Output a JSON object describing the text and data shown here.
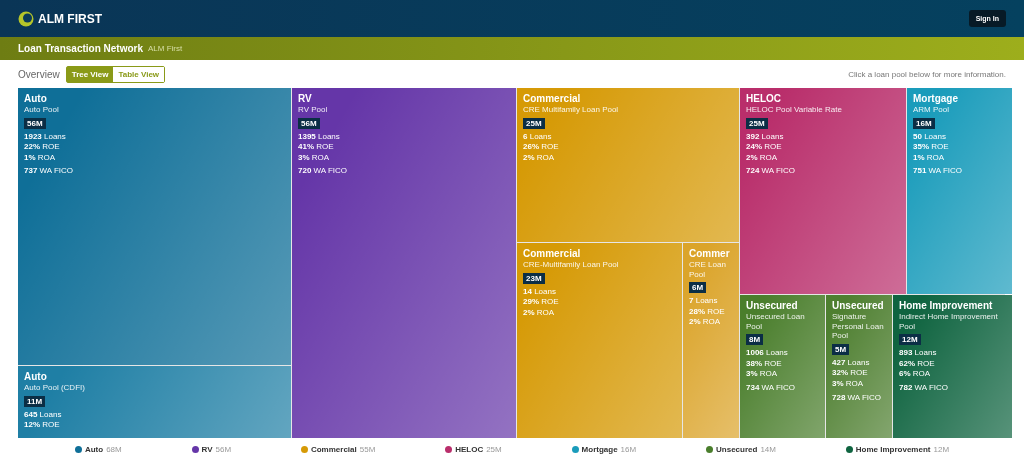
{
  "header": {
    "brand": "ALM FIRST",
    "sign_in": "Sign In"
  },
  "banner": {
    "title": "Loan Transaction Network",
    "subtitle": "ALM First"
  },
  "overview": {
    "title": "Overview",
    "hint": "Click a loan pool below for more information.",
    "views": [
      {
        "label": "Tree View",
        "selected": true
      },
      {
        "label": "Table View",
        "selected": false
      }
    ]
  },
  "tiles": [
    {
      "title": "Auto",
      "pool": "Auto Pool",
      "amount": "56M",
      "color": "#0f6f98",
      "loans": "**1923** Loans",
      "roe": "**22%** ROE",
      "roa": "**1%** ROA",
      "fico": "**737** WA FICO"
    },
    {
      "title": "Auto",
      "pool": "Auto Pool (CDFI)",
      "amount": "11M",
      "color": "#1f7fa5",
      "loans": "**645** Loans",
      "roe": "**12%** ROE"
    },
    {
      "title": "RV",
      "pool": "RV Pool",
      "amount": "56M",
      "color": "#6536a8",
      "loans": "**1395** Loans",
      "roe": "**41%** ROE",
      "roa": "**3%** ROA",
      "fico": "**720** WA FICO"
    },
    {
      "title": "Commercial",
      "pool": "CRE Multifamily Loan Pool",
      "amount": "25M",
      "color": "#d69a06",
      "loans": "**6** Loans",
      "roe": "**26%** ROE",
      "roa": "**2%** ROA"
    },
    {
      "title": "Commercial",
      "pool": "CRE-Multifamily Loan Pool",
      "amount": "23M",
      "color": "#d69a06",
      "loans": "**14** Loans",
      "roe": "**29%** ROE",
      "roa": "**2%** ROA"
    },
    {
      "title": "Commer",
      "pool": "CRE Loan Pool",
      "amount": "6M",
      "color": "#dba42a",
      "loans": "**7** Loans",
      "roe": "**28%** ROE",
      "roa": "**2%** ROA"
    },
    {
      "title": "HELOC",
      "pool": "HELOC Pool Variable Rate",
      "amount": "25M",
      "color": "#b92e6b",
      "loans": "**392** Loans",
      "roe": "**24%** ROE",
      "roa": "**2%** ROA",
      "fico": "**724** WA FICO"
    },
    {
      "title": "Mortgage",
      "pool": "ARM Pool",
      "amount": "16M",
      "color": "#1a9cbb",
      "loans": "**50** Loans",
      "roe": "**35%** ROE",
      "roa": "**1%** ROA",
      "fico": "**751** WA FICO"
    },
    {
      "title": "Unsecured",
      "pool": "Unsecured Loan Pool",
      "amount": "8M",
      "color": "#4a7e2c",
      "loans": "**1006** Loans",
      "roe": "**38%** ROE",
      "roa": "**3%** ROA",
      "fico": "**734** WA FICO"
    },
    {
      "title": "Unsecured",
      "pool": "Signature Personal Loan Pool",
      "amount": "5M",
      "color": "#4e7f30",
      "loans": "**427** Loans",
      "roe": "**32%** ROE",
      "roa": "**3%** ROA",
      "fico": "**728** WA FICO"
    },
    {
      "title": "Home Improvement",
      "pool": "Indirect Home Improvement Pool",
      "amount": "12M",
      "color": "#0f6440",
      "loans": "**893** Loans",
      "roe": "**62%** ROE",
      "roa": "**6%** ROA",
      "fico": "**782** WA FICO"
    }
  ],
  "legend": [
    {
      "name": "Auto",
      "value": "68M",
      "color": "#0f6f98"
    },
    {
      "name": "RV",
      "value": "56M",
      "color": "#6536a8"
    },
    {
      "name": "Commercial",
      "value": "55M",
      "color": "#d69a06"
    },
    {
      "name": "HELOC",
      "value": "25M",
      "color": "#b92e6b"
    },
    {
      "name": "Mortgage",
      "value": "16M",
      "color": "#1a9cbb"
    },
    {
      "name": "Unsecured",
      "value": "14M",
      "color": "#4a7e2c"
    },
    {
      "name": "Home Improvement",
      "value": "12M",
      "color": "#0f6440"
    }
  ]
}
